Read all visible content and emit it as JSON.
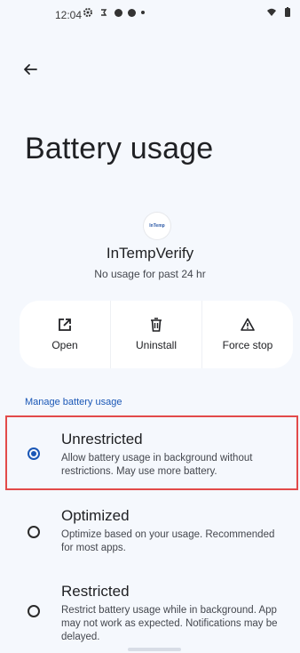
{
  "status_bar": {
    "time": "12:04"
  },
  "page": {
    "title": "Battery usage"
  },
  "app": {
    "icon_label": "InTemp",
    "name": "InTempVerify",
    "usage": "No usage for past 24 hr"
  },
  "actions": [
    {
      "label": "Open",
      "icon": "open-external-icon"
    },
    {
      "label": "Uninstall",
      "icon": "trash-icon"
    },
    {
      "label": "Force stop",
      "icon": "warning-icon"
    }
  ],
  "section": {
    "header": "Manage battery usage"
  },
  "options": [
    {
      "title": "Unrestricted",
      "description": "Allow battery usage in background without restrictions. May use more battery.",
      "selected": true
    },
    {
      "title": "Optimized",
      "description": "Optimize based on your usage. Recommended for most apps.",
      "selected": false
    },
    {
      "title": "Restricted",
      "description": "Restrict battery usage while in background. App may not work as expected. Notifications may be delayed.",
      "selected": false
    }
  ],
  "colors": {
    "accent": "#1a57b6",
    "highlight": "#e24a4a",
    "background": "#f5f8fd"
  }
}
